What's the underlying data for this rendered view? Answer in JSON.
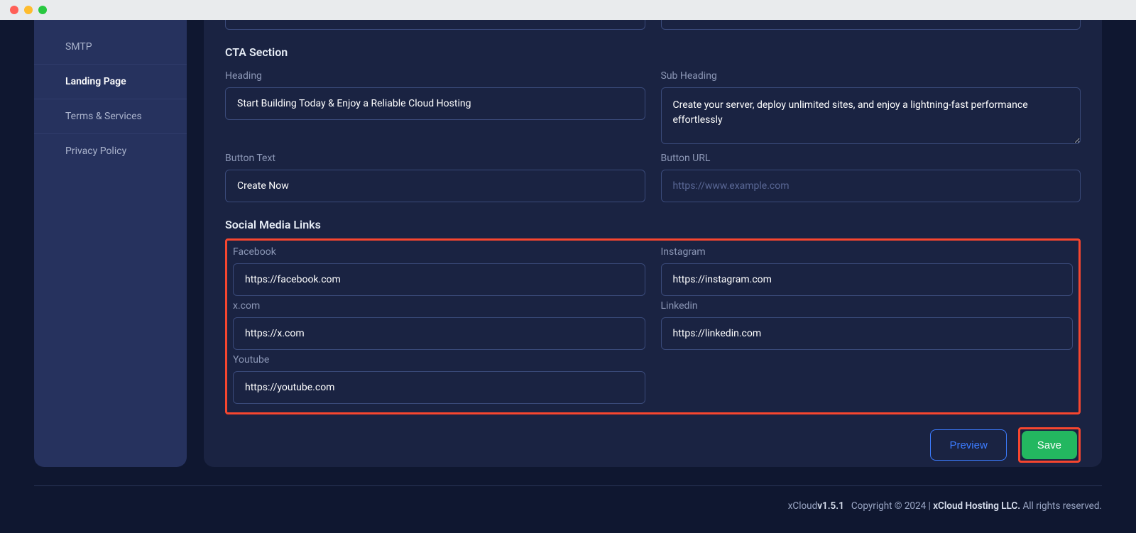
{
  "sidebar": {
    "items": [
      {
        "label": "SMTP",
        "active": false
      },
      {
        "label": "Landing Page",
        "active": true
      },
      {
        "label": "Terms & Services",
        "active": false
      },
      {
        "label": "Privacy Policy",
        "active": false
      }
    ]
  },
  "sections": {
    "cta_title": "CTA Section",
    "social_title": "Social Media Links"
  },
  "cta": {
    "heading_label": "Heading",
    "heading_value": "Start Building Today & Enjoy a Reliable Cloud Hosting",
    "subheading_label": "Sub Heading",
    "subheading_value": "Create your server, deploy unlimited sites, and enjoy a lightning-fast performance effortlessly",
    "button_text_label": "Button Text",
    "button_text_value": "Create Now",
    "button_url_label": "Button URL",
    "button_url_value": "",
    "button_url_placeholder": "https://www.example.com"
  },
  "social": {
    "facebook_label": "Facebook",
    "facebook_value": "https://facebook.com",
    "instagram_label": "Instagram",
    "instagram_value": "https://instagram.com",
    "xcom_label": "x.com",
    "xcom_value": "https://x.com",
    "linkedin_label": "Linkedin",
    "linkedin_value": "https://linkedin.com",
    "youtube_label": "Youtube",
    "youtube_value": "https://youtube.com"
  },
  "buttons": {
    "preview": "Preview",
    "save": "Save"
  },
  "footer": {
    "brand": "xCloud",
    "version": "v1.5.1",
    "copyright": "Copyright © 2024 |",
    "company": "xCloud Hosting LLC.",
    "rights": "All rights reserved."
  }
}
